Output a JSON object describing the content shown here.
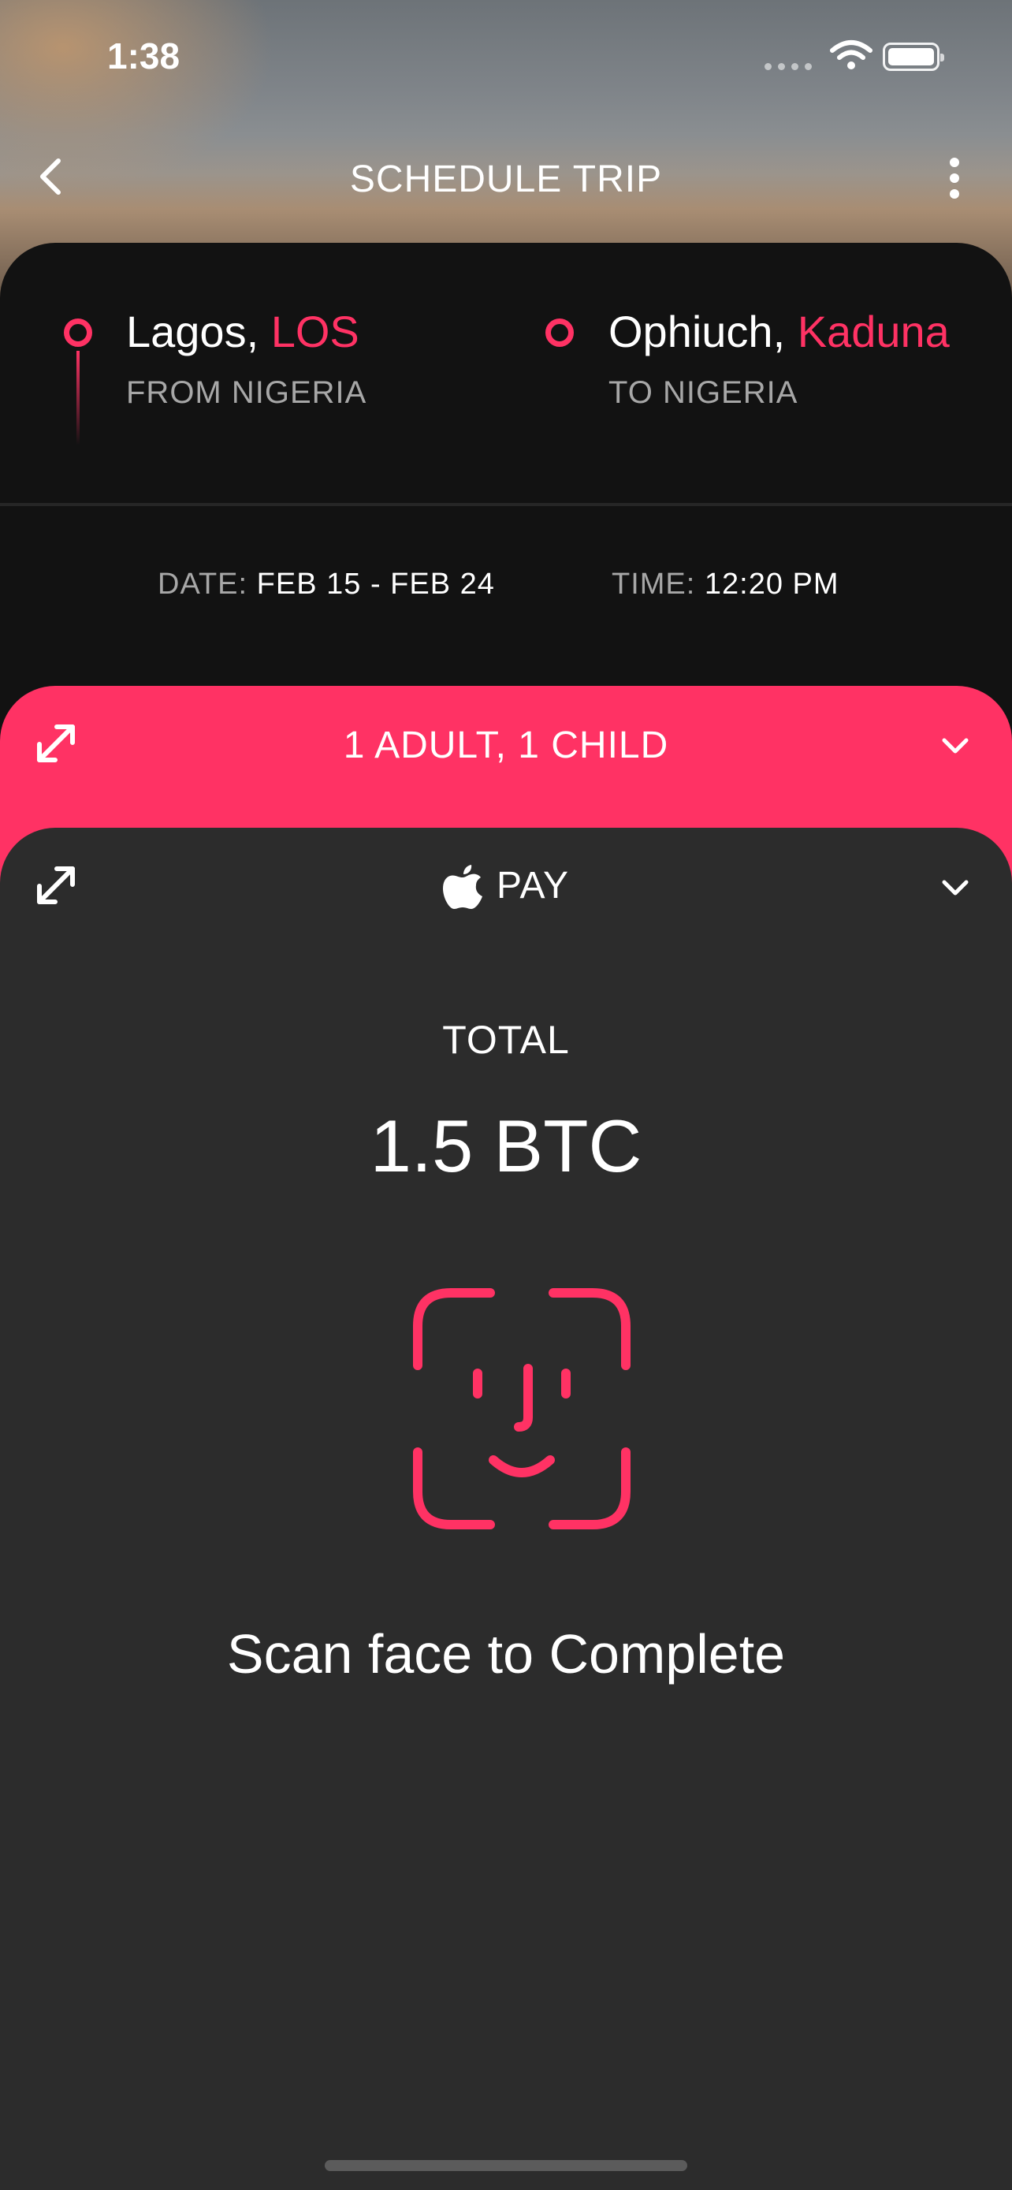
{
  "status_bar": {
    "time": "1:38"
  },
  "header": {
    "title": "SCHEDULE TRIP"
  },
  "route": {
    "from": {
      "city": "Lagos, ",
      "code": "LOS",
      "country": "FROM NIGERIA"
    },
    "to": {
      "city": "Ophiuch, ",
      "code": "Kaduna",
      "country": "TO NIGERIA"
    }
  },
  "schedule": {
    "date_label": "DATE:",
    "date_value": "FEB 15 - FEB 24",
    "time_label": "TIME:",
    "time_value": "12:20 PM"
  },
  "passengers": {
    "label": "1 ADULT, 1 CHILD"
  },
  "payment": {
    "method_label": "PAY",
    "total_label": "TOTAL",
    "total_value": "1.5 BTC",
    "scan_prompt": "Scan face to Complete"
  },
  "colors": {
    "accent": "#ff3264",
    "card_dark": "#121212",
    "card_pay": "#2c2c2c"
  },
  "icons": [
    "back-chevron-icon",
    "more-vertical-icon",
    "location-pin-icon",
    "expand-icon",
    "chevron-down-icon",
    "apple-logo-icon",
    "face-id-icon"
  ]
}
